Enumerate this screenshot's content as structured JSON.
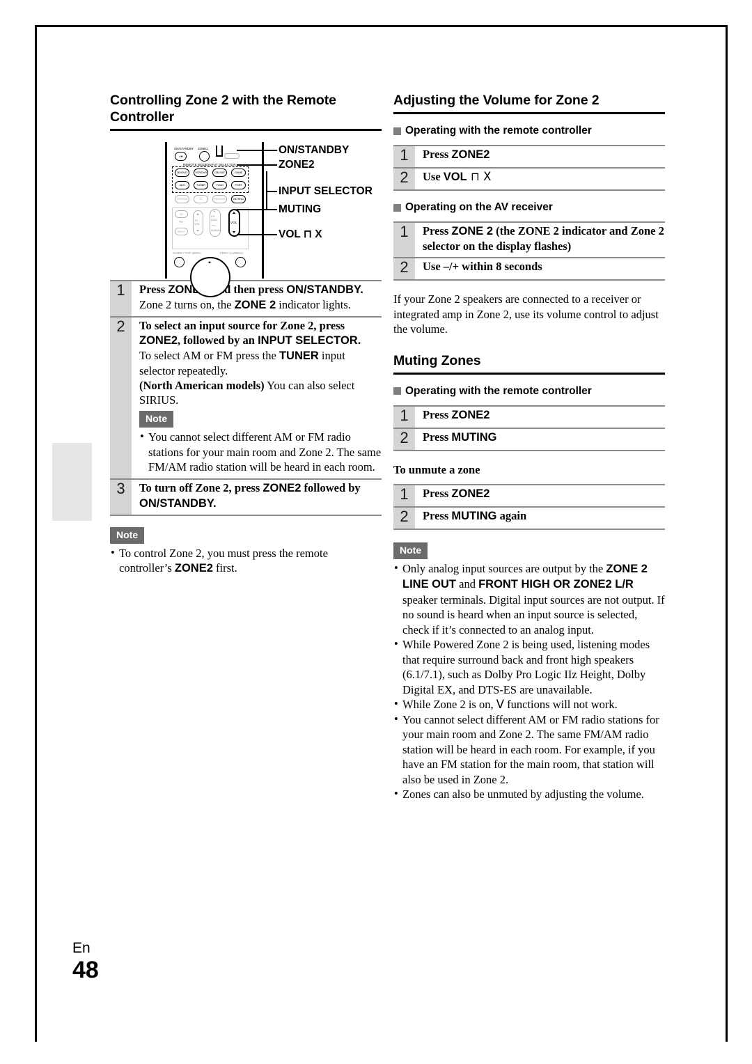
{
  "page": {
    "language_code": "En",
    "page_number": "48"
  },
  "left_column": {
    "heading": "Controlling Zone 2 with the Remote Controller",
    "remote_diagram": {
      "callouts": [
        "ON/STANDBY",
        "ZONE2",
        "INPUT SELECTOR",
        "MUTING",
        "VOL ⊓ X"
      ],
      "top_labels": {
        "on_standby": "ON/STANDBY",
        "zone2": "ZONE2"
      },
      "selector_group_label": "REMOTE MODE/INPUT SELECTOR",
      "input_buttons": [
        "BD/DVD",
        "VCR/DVR",
        "CBL/SAT",
        "GAME",
        "AUX",
        "TUNER",
        "TV/CD",
        "PORT"
      ],
      "second_row_buttons": [
        "CUSTOM",
        "TV",
        "RECORD",
        "MUTING"
      ],
      "lower_buttons": {
        "tv_power": "I/⏻",
        "tv_label": "TV",
        "input_label": "INPUT",
        "tv_vol_label": "TV VOL",
        "ch_disc_label": "CH DISC",
        "album_label": "ALBUM",
        "vol_label": "VOL",
        "guide_top_menu": "GUIDE / TOP MENU",
        "prev_ch_menu": "PREV CH/MENU"
      }
    },
    "steps": [
      {
        "num": "1",
        "title_parts": [
          {
            "t": "Press ",
            "s": "serif-b"
          },
          {
            "t": "ZONE2",
            "s": "sans-b"
          },
          {
            "t": ", and then press ",
            "s": "serif-b"
          },
          {
            "t": "ON/STANDBY.",
            "s": "sans-b"
          }
        ],
        "sub_parts": [
          {
            "t": "Zone 2 turns on, the ",
            "s": "normal"
          },
          {
            "t": "ZONE 2",
            "s": "sans-b"
          },
          {
            "t": " indicator lights.",
            "s": "normal"
          }
        ]
      },
      {
        "num": "2",
        "title_parts": [
          {
            "t": "To select an input source for Zone 2, press ",
            "s": "serif-b"
          },
          {
            "t": "ZONE2",
            "s": "sans-b"
          },
          {
            "t": ", followed by an ",
            "s": "serif-b"
          },
          {
            "t": "INPUT SELECTOR.",
            "s": "sans-b"
          }
        ],
        "sub_parts": [
          {
            "t": "To select AM or FM press the ",
            "s": "normal"
          },
          {
            "t": "TUNER",
            "s": "sans-b"
          },
          {
            "t": " input selector repeatedly.",
            "s": "normal"
          },
          {
            "t": "\n",
            "s": "break"
          },
          {
            "t": "(North American models)",
            "s": "serif-b"
          },
          {
            "t": " You can also select SIRIUS.",
            "s": "normal"
          }
        ],
        "note": {
          "label": "Note",
          "items": [
            "You cannot select different AM or FM radio stations for your main room and Zone 2. The same FM/AM radio station will be heard in each room."
          ]
        }
      },
      {
        "num": "3",
        "title_parts": [
          {
            "t": "To turn off Zone 2, press ",
            "s": "serif-b"
          },
          {
            "t": "ZONE2",
            "s": "sans-b"
          },
          {
            "t": " followed by ",
            "s": "serif-b"
          },
          {
            "t": "ON/STANDBY.",
            "s": "sans-b"
          }
        ],
        "sub_parts": []
      }
    ],
    "bottom_note": {
      "label": "Note",
      "items_parts": [
        [
          {
            "t": "To control Zone 2, you must press the remote controller’s ",
            "s": "normal"
          },
          {
            "t": "ZONE2",
            "s": "sans-b"
          },
          {
            "t": " first.",
            "s": "normal"
          }
        ]
      ]
    }
  },
  "right_column": {
    "section_volume": {
      "heading": "Adjusting the Volume for Zone 2",
      "sub_remote": {
        "label": "Operating with the remote controller",
        "steps": [
          {
            "num": "1",
            "title_parts": [
              {
                "t": "Press ",
                "s": "serif-b"
              },
              {
                "t": "ZONE2",
                "s": "sans-b"
              }
            ]
          },
          {
            "num": "2",
            "title_parts": [
              {
                "t": "Use ",
                "s": "serif-b"
              },
              {
                "t": "VOL",
                "s": "sans-b"
              },
              {
                "t": "  ⊓ X",
                "s": "glyph"
              }
            ]
          }
        ]
      },
      "sub_receiver": {
        "label": "Operating on the AV receiver",
        "steps": [
          {
            "num": "1",
            "title_parts": [
              {
                "t": "Press ",
                "s": "serif-b"
              },
              {
                "t": "ZONE 2",
                "s": "sans-b"
              },
              {
                "t": " (the ZONE 2 indicator and Zone 2 selector on the display flashes)",
                "s": "serif-b"
              }
            ]
          },
          {
            "num": "2",
            "title_parts": [
              {
                "t": "Use –/+ within 8 seconds",
                "s": "serif-b"
              }
            ]
          }
        ]
      },
      "paragraph": "If your Zone 2 speakers are connected to a receiver or integrated amp in Zone 2, use its volume control to adjust the volume."
    },
    "section_muting": {
      "heading": "Muting Zones",
      "sub_remote": {
        "label": "Operating with the remote controller",
        "steps": [
          {
            "num": "1",
            "title_parts": [
              {
                "t": "Press ",
                "s": "serif-b"
              },
              {
                "t": "ZONE2",
                "s": "sans-b"
              }
            ]
          },
          {
            "num": "2",
            "title_parts": [
              {
                "t": "Press ",
                "s": "serif-b"
              },
              {
                "t": "MUTING",
                "s": "sans-b"
              }
            ]
          }
        ]
      },
      "unmute_heading": "To unmute a zone",
      "unmute_steps": [
        {
          "num": "1",
          "title_parts": [
            {
              "t": "Press ",
              "s": "serif-b"
            },
            {
              "t": "ZONE2",
              "s": "sans-b"
            }
          ]
        },
        {
          "num": "2",
          "title_parts": [
            {
              "t": "Press ",
              "s": "serif-b"
            },
            {
              "t": "MUTING",
              "s": "sans-b"
            },
            {
              "t": " again",
              "s": "serif-b"
            }
          ]
        }
      ],
      "note": {
        "label": "Note",
        "items_parts": [
          [
            {
              "t": "Only analog input sources are output by the ",
              "s": "normal"
            },
            {
              "t": "ZONE 2 LINE OUT",
              "s": "sans-b"
            },
            {
              "t": " and ",
              "s": "normal"
            },
            {
              "t": "FRONT HIGH OR ZONE2 L/R",
              "s": "sans-b"
            },
            {
              "t": " speaker terminals. Digital input sources are not output. If no sound is heard when an input source is selected, check if it’s connected to an analog input.",
              "s": "normal"
            }
          ],
          [
            {
              "t": "While Powered Zone 2 is being used, listening modes that require surround back and front high speakers (6.1/7.1), such as Dolby Pro Logic IIz Height, Dolby Digital EX, and DTS-ES are unavailable.",
              "s": "normal"
            }
          ],
          [
            {
              "t": "While Zone 2 is on, ",
              "s": "normal"
            },
            {
              "t": "V",
              "s": "glyph"
            },
            {
              "t": "  functions will not work.",
              "s": "normal"
            }
          ],
          [
            {
              "t": "You cannot select different AM or FM radio stations for your main room and Zone 2. The same FM/AM radio station will be heard in each room. For example, if you have an FM station for the main room, that station will also be used in Zone 2.",
              "s": "normal"
            }
          ],
          [
            {
              "t": "Zones can also be unmuted by adjusting the volume.",
              "s": "normal"
            }
          ]
        ]
      }
    }
  },
  "colors": {
    "note_tag_bg": "#6b6b6b",
    "step_num_bg": "#d4d4d4",
    "rule": "#8a8a8a",
    "side_tab": "#e6e6e6"
  }
}
